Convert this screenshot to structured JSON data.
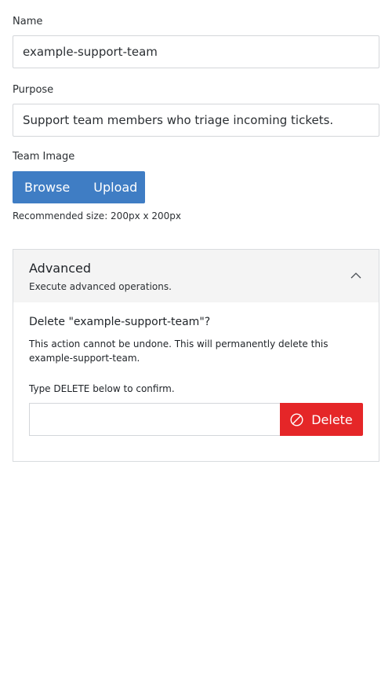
{
  "form": {
    "name": {
      "label": "Name",
      "value": "example-support-team"
    },
    "purpose": {
      "label": "Purpose",
      "value": "Support team members who triage incoming tickets."
    },
    "team_image": {
      "label": "Team Image",
      "browse_label": "Browse",
      "upload_label": "Upload",
      "hint": "Recommended size: 200px x 200px"
    }
  },
  "advanced": {
    "title": "Advanced",
    "subtitle": "Execute advanced operations.",
    "expanded": true,
    "delete": {
      "title": "Delete \"example-support-team\"?",
      "description": "This action cannot be undone. This will permanently delete this example-support-team.",
      "confirm_instruction": "Type DELETE below to confirm.",
      "confirm_value": "",
      "button_label": "Delete",
      "button_icon": "ban-icon"
    }
  },
  "colors": {
    "primary": "#3f7dc4",
    "danger": "#e52628",
    "panel_header_bg": "#f4f4f4"
  }
}
